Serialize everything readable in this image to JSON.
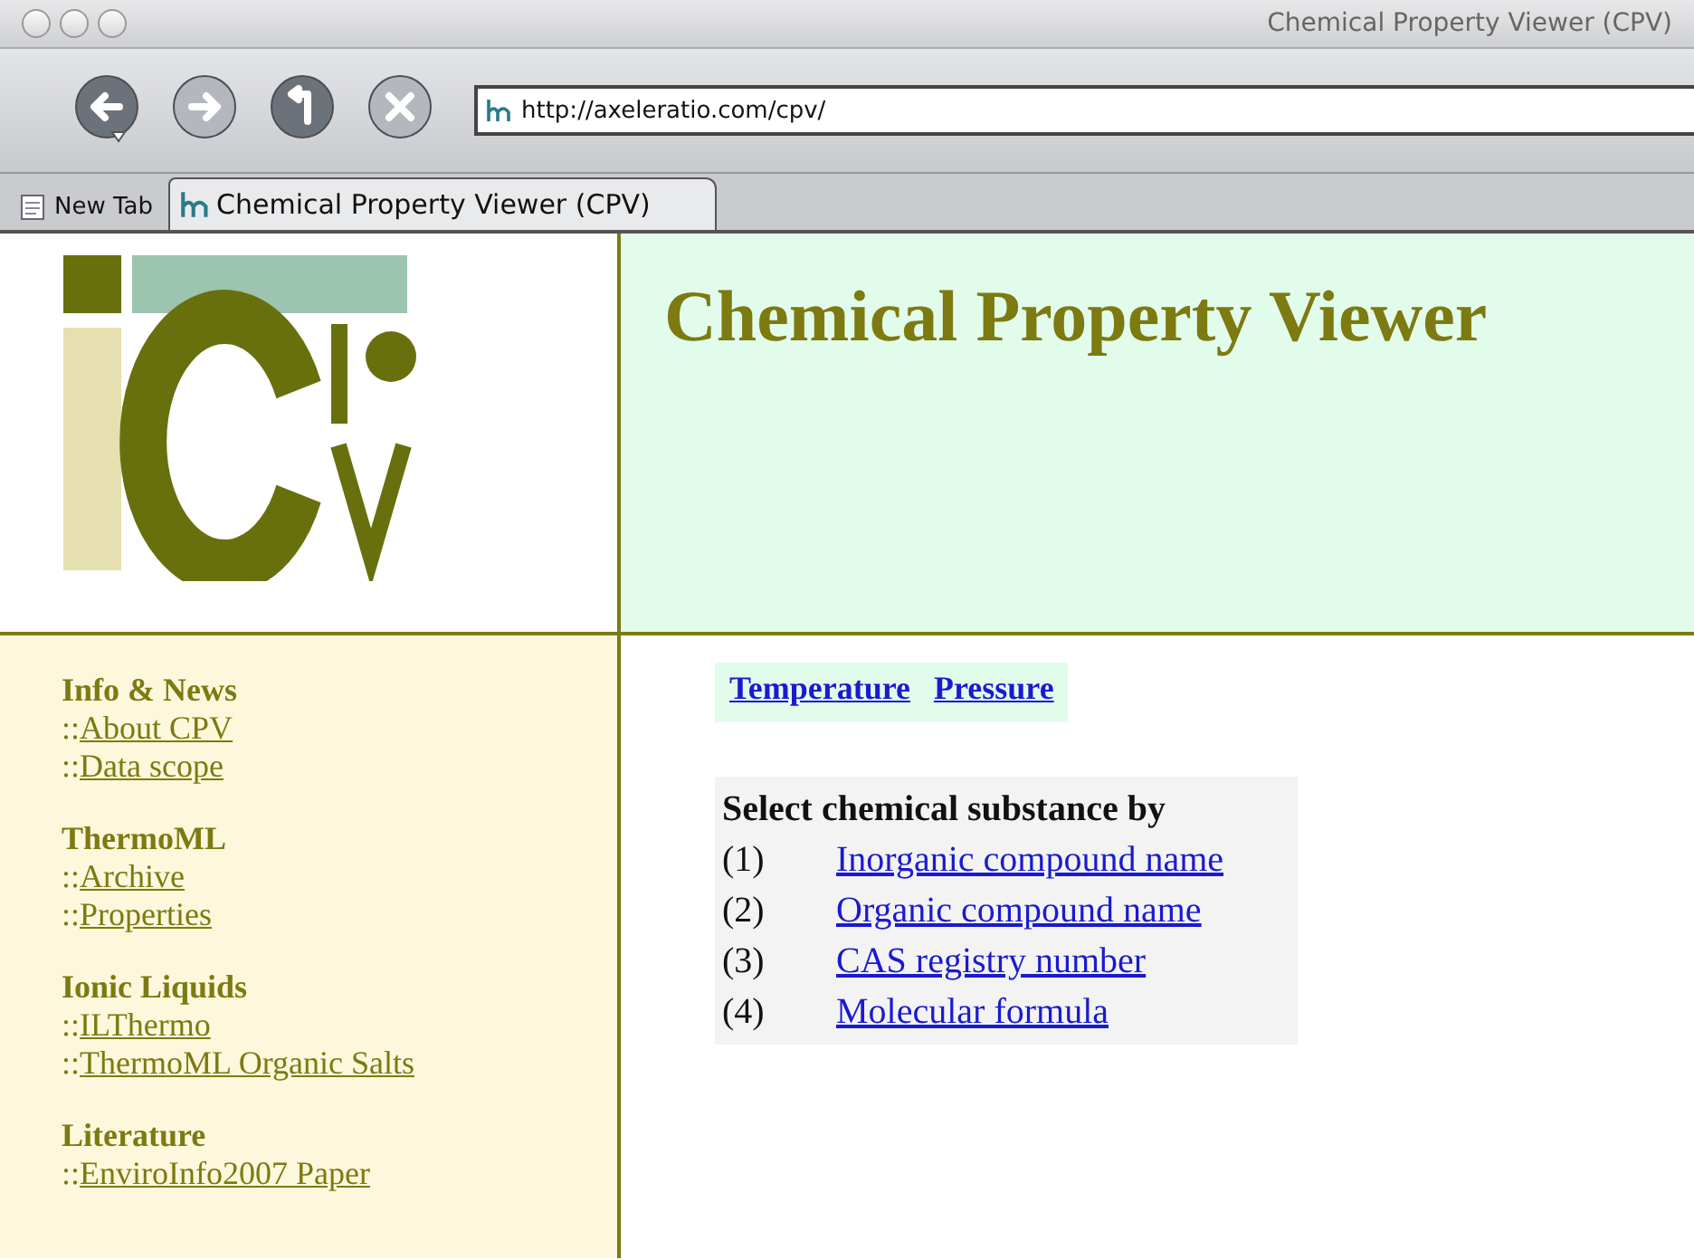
{
  "window": {
    "title": "Chemical Property Viewer (CPV)"
  },
  "toolbar": {
    "buttons": [
      {
        "kind": "back",
        "disabled": false
      },
      {
        "kind": "forward",
        "disabled": true
      },
      {
        "kind": "reload",
        "disabled": false
      },
      {
        "kind": "stop",
        "disabled": true
      }
    ],
    "address": "http://axeleratio.com/cpv/"
  },
  "tabs": [
    {
      "label": "New Tab",
      "kind": "new",
      "selected": false
    },
    {
      "label": "Chemical Property Viewer (CPV)",
      "kind": "page",
      "selected": true
    }
  ],
  "page": {
    "heading": "Chemical Property Viewer",
    "sidebar": [
      {
        "title": "Info & News",
        "links": [
          "About CPV",
          "Data scope"
        ]
      },
      {
        "title": "ThermoML",
        "links": [
          "Archive",
          "Properties"
        ]
      },
      {
        "title": "Ionic Liquids",
        "links": [
          "ILThermo",
          "ThermoML Organic Salts"
        ]
      },
      {
        "title": "Literature",
        "links": [
          "EnviroInfo2007 Paper"
        ]
      }
    ],
    "link_prefix": "::",
    "property_links": [
      "Temperature",
      "Pressure"
    ],
    "select": {
      "heading": "Select chemical substance by",
      "options": [
        {
          "number": "(1)",
          "label": "Inorganic compound name"
        },
        {
          "number": "(2)",
          "label": "Organic compound name"
        },
        {
          "number": "(3)",
          "label": "CAS registry number"
        },
        {
          "number": "(4)",
          "label": "Molecular formula"
        }
      ]
    }
  }
}
